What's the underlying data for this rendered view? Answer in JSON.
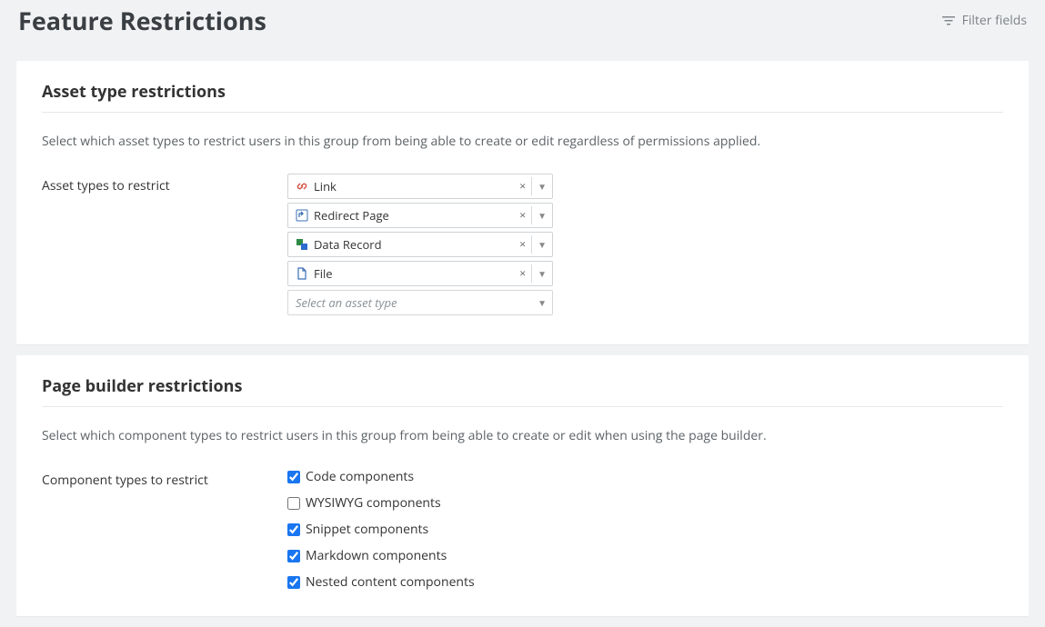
{
  "header": {
    "title": "Feature Restrictions",
    "filter_label": "Filter fields"
  },
  "section1": {
    "heading": "Asset type restrictions",
    "help": "Select which asset types to restrict users in this group from being able to create or edit regardless of permissions applied.",
    "field_label": "Asset types to restrict",
    "assets": [
      {
        "label": "Link",
        "icon": "link"
      },
      {
        "label": "Redirect Page",
        "icon": "redirect"
      },
      {
        "label": "Data Record",
        "icon": "data"
      },
      {
        "label": "File",
        "icon": "file"
      }
    ],
    "placeholder": "Select an asset type"
  },
  "section2": {
    "heading": "Page builder restrictions",
    "help": "Select which component types to restrict users in this group from being able to create or edit when using the page builder.",
    "field_label": "Component types to restrict",
    "components": [
      {
        "label": "Code components",
        "checked": true
      },
      {
        "label": "WYSIWYG components",
        "checked": false
      },
      {
        "label": "Snippet components",
        "checked": true
      },
      {
        "label": "Markdown components",
        "checked": true
      },
      {
        "label": "Nested content components",
        "checked": true
      }
    ]
  }
}
